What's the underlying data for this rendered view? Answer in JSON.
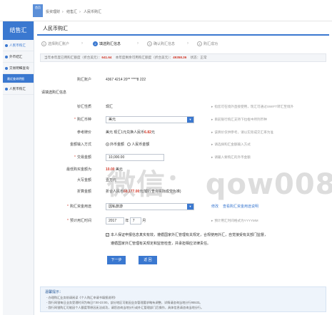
{
  "header": {
    "logo_text": "首页",
    "breadcrumbs": [
      "投资理财",
      "结售汇",
      "人民币购汇"
    ]
  },
  "sidebar": {
    "title": "结售汇",
    "items": [
      {
        "label": "人民币购汇"
      },
      {
        "label": "外币结汇"
      },
      {
        "label": "交易明细查询"
      },
      {
        "label": "最近查询明细"
      },
      {
        "label": "人民币购汇"
      }
    ]
  },
  "main": {
    "title": "人民币购汇",
    "steps": [
      {
        "num": "1",
        "label": "选择购汇账户"
      },
      {
        "num": "2",
        "label": "填选购汇信息"
      },
      {
        "num": "3",
        "label": "确认购汇信息"
      },
      {
        "num": "4",
        "label": "购汇成功"
      }
    ],
    "quota": {
      "prefix": "当年本年度已用购汇额度（折合美元）：",
      "used": "641.64",
      "middle": "本年度剩余可用购汇额度（折合美元）：",
      "remaining": "49358.36",
      "suffix": "状态：正常"
    },
    "account_label": "购汇账户",
    "account_value": "4367 4214 20** ****8 222",
    "section_title": "请填选购汇信息",
    "fields": {
      "rate_label": "钞汇性质",
      "rate_value": "现汇",
      "rate_hint": "指您可在境外直接使用，现汇可通过SWIFT转汇至境外",
      "currency_label": "购汇币种",
      "currency_value": "美元",
      "currency_hint": "目前银行购汇支持下拉框中所列币种",
      "ref_label": "参考牌价",
      "ref_value_prefix": "美元 现汇1元兑换人民币",
      "ref_value": "6.82",
      "ref_value_suffix": "元",
      "ref_hint": "该牌价仅供参考，请以实际成交汇率为准",
      "mode_label": "金额输入方式",
      "mode_options": [
        "外币金额",
        "人民币金额"
      ],
      "mode_hint": "请选择购汇金额输入方式",
      "amount_label": "交易金额",
      "amount_value": "10,000.00",
      "amount_hint": "请输入要购汇的外币金额",
      "max_label": "最低购买金额为",
      "max_value": "10.00",
      "max_unit": "美元",
      "upper_label": "大写金额",
      "upper_value": "壹万元",
      "cny_label": "折算金额",
      "cny_prefix": "折合人民币",
      "cny_value": "68,177.00",
      "cny_suffix": "元(银行查询实际成交为准)",
      "purpose_label": "购汇资金用途",
      "purpose_value": "因私旅游",
      "purpose_link1": "修改",
      "purpose_link2": "查看购汇资金用途说明",
      "date_label": "预计用汇时间",
      "date_year": "2017",
      "date_sep": "年",
      "date_month": "7",
      "date_month_suffix": "月",
      "date_hint": "预计用汇时间格式为YYYYMM",
      "consent_line1": "本人保证申报信息真实有效，遵循国家外汇管理有关规定，合规使用外汇，自觉接受有关部门监督，",
      "consent_line2": "遵循国家外汇管理有关规定和监管检查，并承担相应法律责任。"
    },
    "buttons": {
      "next": "下一步",
      "back": "返 回"
    },
    "tips": {
      "title": "温馨提示：",
      "lines": [
        "- 办理购汇业务前请阅读《个人购汇申请书填报说明》",
        "- 我行网银每日业务受理时间为每日7:00-23:00，部分地区可能因业务管理要求略有调整，详情请咨询当地分行95533。",
        "- 我行网银购汇可能因个人额度等原因无法成功，请您咨询当地分行或外汇管理部门后操作，具体信息请咨询当地分行。"
      ]
    }
  },
  "watermark": "微信： qow008"
}
